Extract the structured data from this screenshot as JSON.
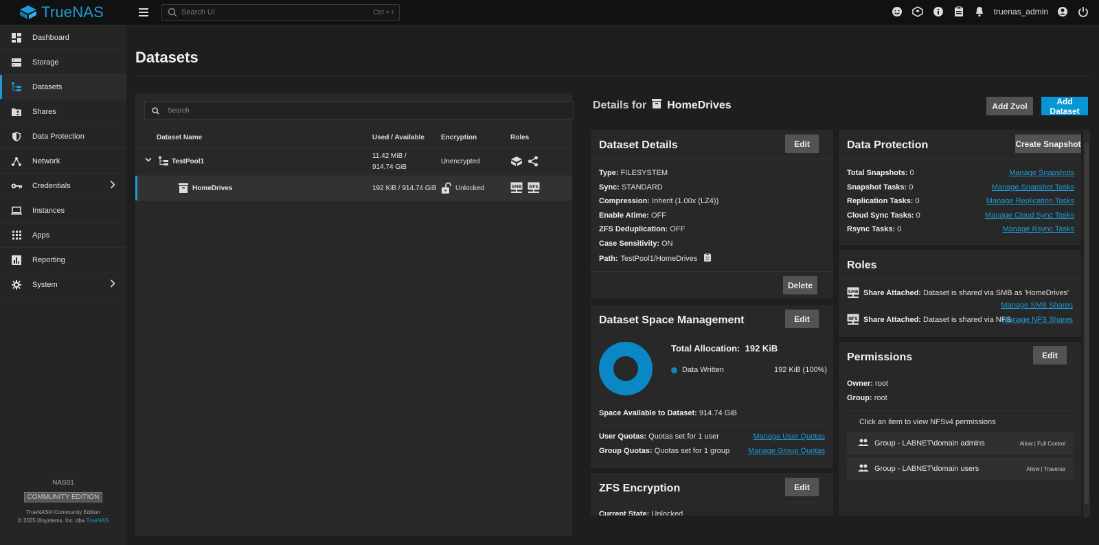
{
  "app": {
    "logo": "TrueNAS",
    "brand_color": "#0895d4"
  },
  "topbar": {
    "search_placeholder": "Search UI",
    "search_shortcut": "Ctrl + /",
    "user": "truenas_admin",
    "icons": [
      "feedback-icon",
      "truecommand-icon",
      "help-icon",
      "jobs-icon",
      "notifications-icon",
      "account-icon",
      "power-icon"
    ]
  },
  "sidebar": {
    "items": [
      {
        "label": "Dashboard",
        "icon": "dashboard-icon"
      },
      {
        "label": "Storage",
        "icon": "storage-icon"
      },
      {
        "label": "Datasets",
        "icon": "datasets-icon",
        "active": true
      },
      {
        "label": "Shares",
        "icon": "shares-icon"
      },
      {
        "label": "Data Protection",
        "icon": "shield-icon"
      },
      {
        "label": "Network",
        "icon": "network-icon"
      },
      {
        "label": "Credentials",
        "icon": "key-icon",
        "has_submenu": true
      },
      {
        "label": "Instances",
        "icon": "laptop-icon"
      },
      {
        "label": "Apps",
        "icon": "apps-grid-icon"
      },
      {
        "label": "Reporting",
        "icon": "chart-icon"
      },
      {
        "label": "System",
        "icon": "gear-icon",
        "has_submenu": true
      }
    ],
    "footer": {
      "hostname": "NAS01",
      "edition_badge": "COMMUNITY EDITION",
      "copyright_line1": "TrueNAS® Community Edition",
      "copyright_line2_prefix": "© 2025 iXsystems, Inc. dba ",
      "copyright_link": "TrueNAS"
    }
  },
  "page": {
    "title": "Datasets"
  },
  "tree": {
    "search_placeholder": "Search",
    "columns": [
      "Dataset Name",
      "Used / Available",
      "Encryption",
      "Roles"
    ],
    "rows": [
      {
        "name": "TestPool1",
        "used_line1": "11.42 MiB /",
        "used_line2": "914.74 GiB",
        "encryption": "Unencrypted",
        "roles": [
          "pool-icon",
          "share-icon"
        ]
      },
      {
        "name": "HomeDrives",
        "used": "192 KiB / 914.74 GiB",
        "encryption": "Unlocked",
        "roles": [
          "smb-icon",
          "nfs-icon"
        ],
        "selected": true
      }
    ]
  },
  "details": {
    "prefix": "Details for",
    "dataset": "HomeDrives",
    "add_zvol": "Add Zvol",
    "add_dataset": "Add Dataset"
  },
  "dataset_details": {
    "title": "Dataset Details",
    "edit": "Edit",
    "delete": "Delete",
    "fields": [
      {
        "k": "Type:",
        "v": "FILESYSTEM"
      },
      {
        "k": "Sync:",
        "v": "STANDARD"
      },
      {
        "k": "Compression:",
        "v": "Inherit (1.00x (LZ4))"
      },
      {
        "k": "Enable Atime:",
        "v": "OFF"
      },
      {
        "k": "ZFS Deduplication:",
        "v": "OFF"
      },
      {
        "k": "Case Sensitivity:",
        "v": "ON"
      },
      {
        "k": "Path:",
        "v": "TestPool1/HomeDrives"
      }
    ]
  },
  "space": {
    "title": "Dataset Space Management",
    "edit": "Edit",
    "total_label": "Total Allocation:",
    "total_value": "192 KiB",
    "legend_label": "Data Written",
    "legend_value": "192 KiB (100%)",
    "chart_fraction": 1.0,
    "available_label": "Space Available to Dataset:",
    "available_value": "914.74 GiB",
    "user_quotas_label": "User Quotas:",
    "user_quotas_value": "Quotas set for 1 user",
    "user_quotas_link": "Manage User Quotas",
    "group_quotas_label": "Group Quotas:",
    "group_quotas_value": "Quotas set for 1 group",
    "group_quotas_link": "Manage Group Quotas"
  },
  "encryption": {
    "title": "ZFS Encryption",
    "edit": "Edit",
    "state_label": "Current State:",
    "state_value": "Unlocked"
  },
  "data_protection": {
    "title": "Data Protection",
    "create": "Create Snapshot",
    "rows": [
      {
        "k": "Total Snapshots:",
        "v": "0",
        "link": "Manage Snapshots"
      },
      {
        "k": "Snapshot Tasks:",
        "v": "0",
        "link": "Manage Snapshot Tasks"
      },
      {
        "k": "Replication Tasks:",
        "v": "0",
        "link": "Manage Replication Tasks"
      },
      {
        "k": "Cloud Sync Tasks:",
        "v": "0",
        "link": "Manage Cloud Sync Tasks"
      },
      {
        "k": "Rsync Tasks:",
        "v": "0",
        "link": "Manage Rsync Tasks"
      }
    ]
  },
  "roles": {
    "title": "Roles",
    "smb_label": "Share Attached:",
    "smb_text": "Dataset is shared via SMB as 'HomeDrives'",
    "smb_link": "Manage SMB Shares",
    "nfs_label": "Share Attached:",
    "nfs_text": "Dataset is shared via NFS",
    "nfs_link": "Manage NFS Shares"
  },
  "permissions": {
    "title": "Permissions",
    "edit": "Edit",
    "owner_label": "Owner:",
    "owner_value": "root",
    "group_label": "Group:",
    "group_value": "root",
    "hint": "Click an item to view NFSv4 permissions",
    "entries": [
      {
        "name": "Group - LABNET\\domain admins",
        "perm": "Allow | Full Control"
      },
      {
        "name": "Group - LABNET\\domain users",
        "perm": "Allow | Traverse"
      }
    ]
  }
}
